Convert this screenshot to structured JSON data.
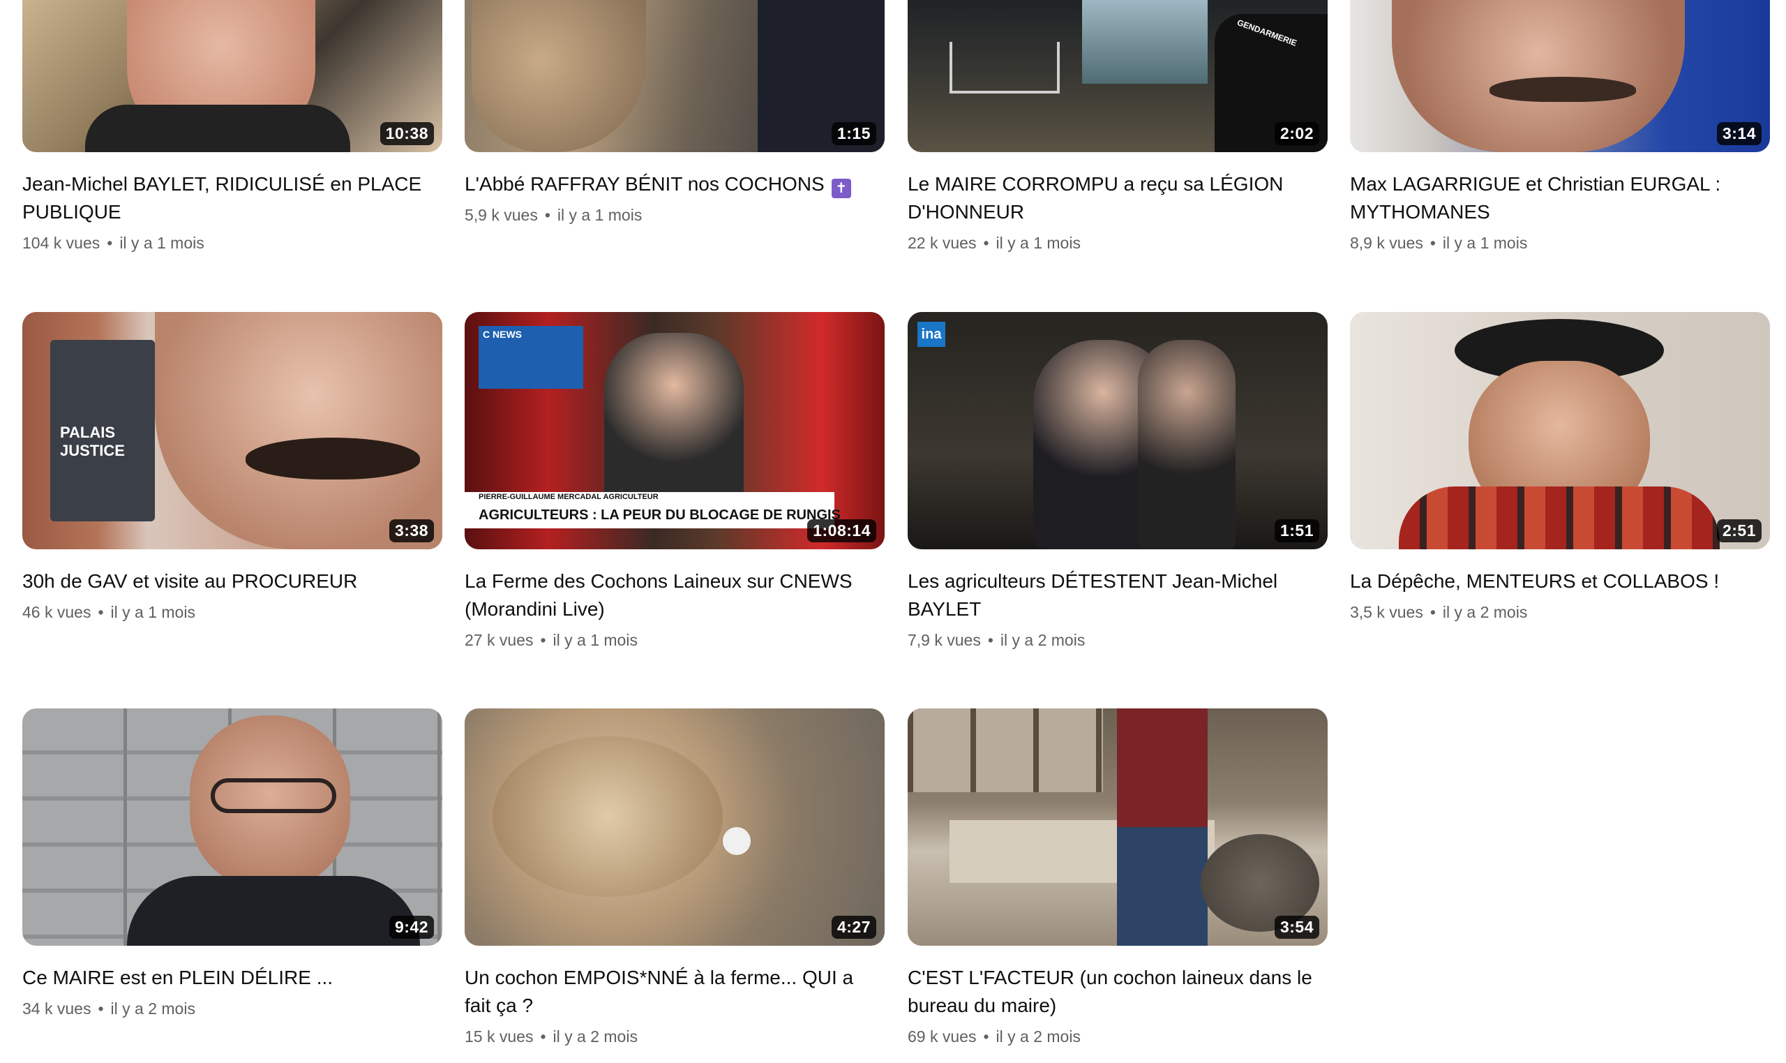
{
  "videos": [
    {
      "title": "Jean-Michel BAYLET, RIDICULISÉ en PLACE PUBLIQUE",
      "views": "104 k vues",
      "age": "il y a 1 mois",
      "duration": "10:38"
    },
    {
      "title": "L'Abbé RAFFRAY BÉNIT nos COCHONS",
      "title_icon": "cross-emoji",
      "views": "5,9 k vues",
      "age": "il y a 1 mois",
      "duration": "1:15"
    },
    {
      "title": "Le MAIRE CORROMPU a reçu sa LÉGION D'HONNEUR",
      "views": "22 k vues",
      "age": "il y a 1 mois",
      "duration": "2:02"
    },
    {
      "title": "Max LAGARRIGUE et Christian EURGAL : MYTHOMANES",
      "views": "8,9 k vues",
      "age": "il y a 1 mois",
      "duration": "3:14"
    },
    {
      "title": "30h de GAV et visite au PROCUREUR",
      "views": "46 k vues",
      "age": "il y a 1 mois",
      "duration": "3:38"
    },
    {
      "title": "La Ferme des Cochons Laineux sur CNEWS (Morandini Live)",
      "views": "27 k vues",
      "age": "il y a 1 mois",
      "duration": "1:08:14",
      "overlay_banner": "AGRICULTEURS : LA PEUR DU BLOCAGE DE RUNGIS",
      "overlay_name": "PIERRE-GUILLAUME MERCADAL AGRICULTEUR",
      "overlay_logo": "C NEWS"
    },
    {
      "title": "Les agriculteurs DÉTESTENT Jean-Michel BAYLET",
      "views": "7,9 k vues",
      "age": "il y a 2 mois",
      "duration": "1:51",
      "overlay_logo": "ina"
    },
    {
      "title": "La Dépêche, MENTEURS et COLLABOS !",
      "views": "3,5 k vues",
      "age": "il y a 2 mois",
      "duration": "2:51"
    },
    {
      "title": "Ce MAIRE est en PLEIN DÉLIRE ...",
      "views": "34 k vues",
      "age": "il y a 2 mois",
      "duration": "9:42"
    },
    {
      "title": "Un cochon EMPOIS*NNÉ à la ferme... QUI a fait ça ?",
      "views": "15 k vues",
      "age": "il y a 2 mois",
      "duration": "4:27"
    },
    {
      "title": "C'EST L'FACTEUR (un cochon laineux dans le bureau du maire)",
      "views": "69 k vues",
      "age": "il y a 2 mois",
      "duration": "3:54"
    }
  ],
  "separator": "•",
  "thumb2_sign": "GENDARMERIE",
  "thumb5_sign": "PALAIS JUSTICE"
}
